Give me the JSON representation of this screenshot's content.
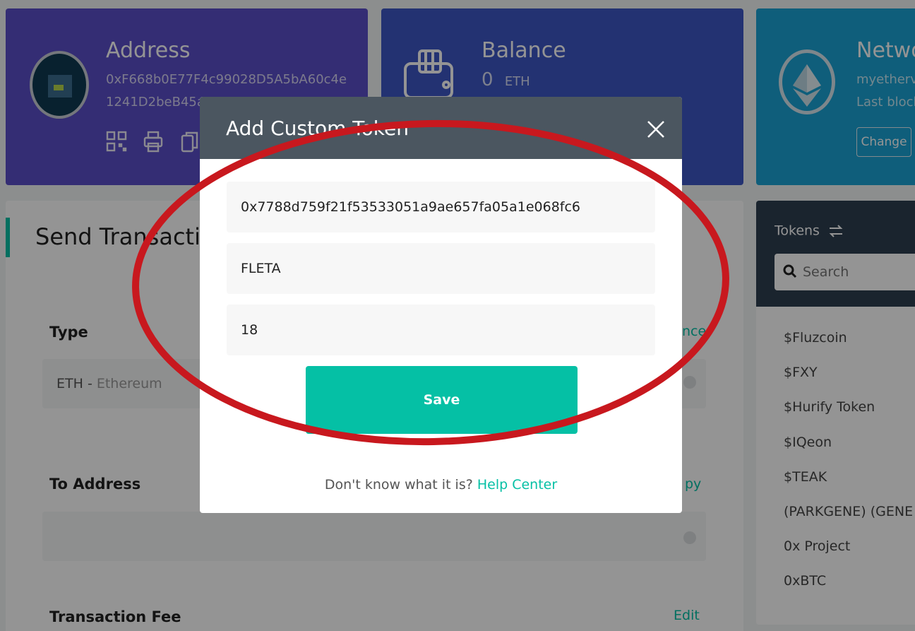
{
  "address_card": {
    "title": "Address",
    "address_line1": "0xF668b0E77F4c99028D5A5bA60c4e",
    "address_line2": "1241D2beB45a"
  },
  "balance_card": {
    "title": "Balance",
    "value": "0",
    "unit": "ETH"
  },
  "network_card": {
    "title": "Netwo",
    "line1": "myetherv",
    "line2": "Last block",
    "change_label": "Change"
  },
  "send_panel": {
    "title": "Send Transacti",
    "type_label": "Type",
    "type_link": "nce",
    "type_value_code": "ETH",
    "type_value_sep": " - ",
    "type_value_name": "Ethereum",
    "to_label": "To Address",
    "to_link": "py",
    "fee_label": "Transaction Fee",
    "fee_link": "Edit"
  },
  "tokens_panel": {
    "title": "Tokens",
    "search_placeholder": "Search",
    "items": [
      "$Fluzcoin",
      "$FXY",
      "$Hurify Token",
      "$IQeon",
      "$TEAK",
      "(PARKGENE) (GENE",
      "0x Project",
      "0xBTC"
    ]
  },
  "modal": {
    "title": "Add Custom Token",
    "contract_value": "0x7788d759f21f53533051a9ae657fa05a1e068fc6",
    "symbol_value": "FLETA",
    "decimals_value": "18",
    "save_label": "Save",
    "help_text": "Don't know what it is?",
    "help_link": "Help Center"
  },
  "colors": {
    "accent": "#05c0a5",
    "annotation": "#c8181e",
    "address_card": "#5b4fc9",
    "balance_card": "#3d57c5",
    "network_card": "#1aa3d4"
  }
}
